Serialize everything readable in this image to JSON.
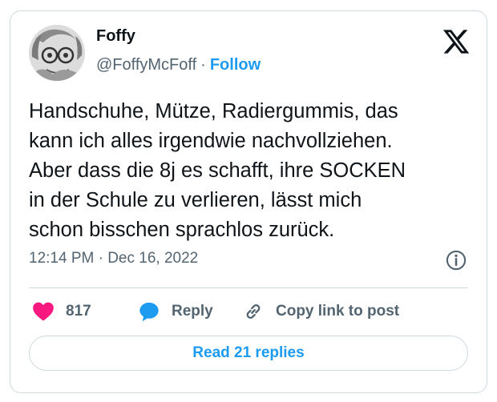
{
  "author": {
    "name": "Foffy",
    "handle": "@FoffyMcFoff",
    "separator": "·",
    "follow_label": "Follow"
  },
  "platform_icon": "x-logo-icon",
  "tweet": {
    "text": "Handschuhe, Mütze, Radiergummis, das\nkann ich alles irgendwie nachvollziehen.\nAber dass die 8j es schafft, ihre SOCKEN\nin der Schule zu verlieren, lässt mich\nschon bisschen sprachlos zurück.",
    "timestamp": "12:14 PM · Dec 16, 2022"
  },
  "actions": {
    "likes_count": "817",
    "reply_label": "Reply",
    "copy_link_label": "Copy link to post"
  },
  "read_replies_label": "Read 21 replies",
  "colors": {
    "accent": "#1d9bf0",
    "like": "#f91880",
    "text": "#0f1419",
    "secondary": "#536471",
    "border": "#cfd9de"
  }
}
